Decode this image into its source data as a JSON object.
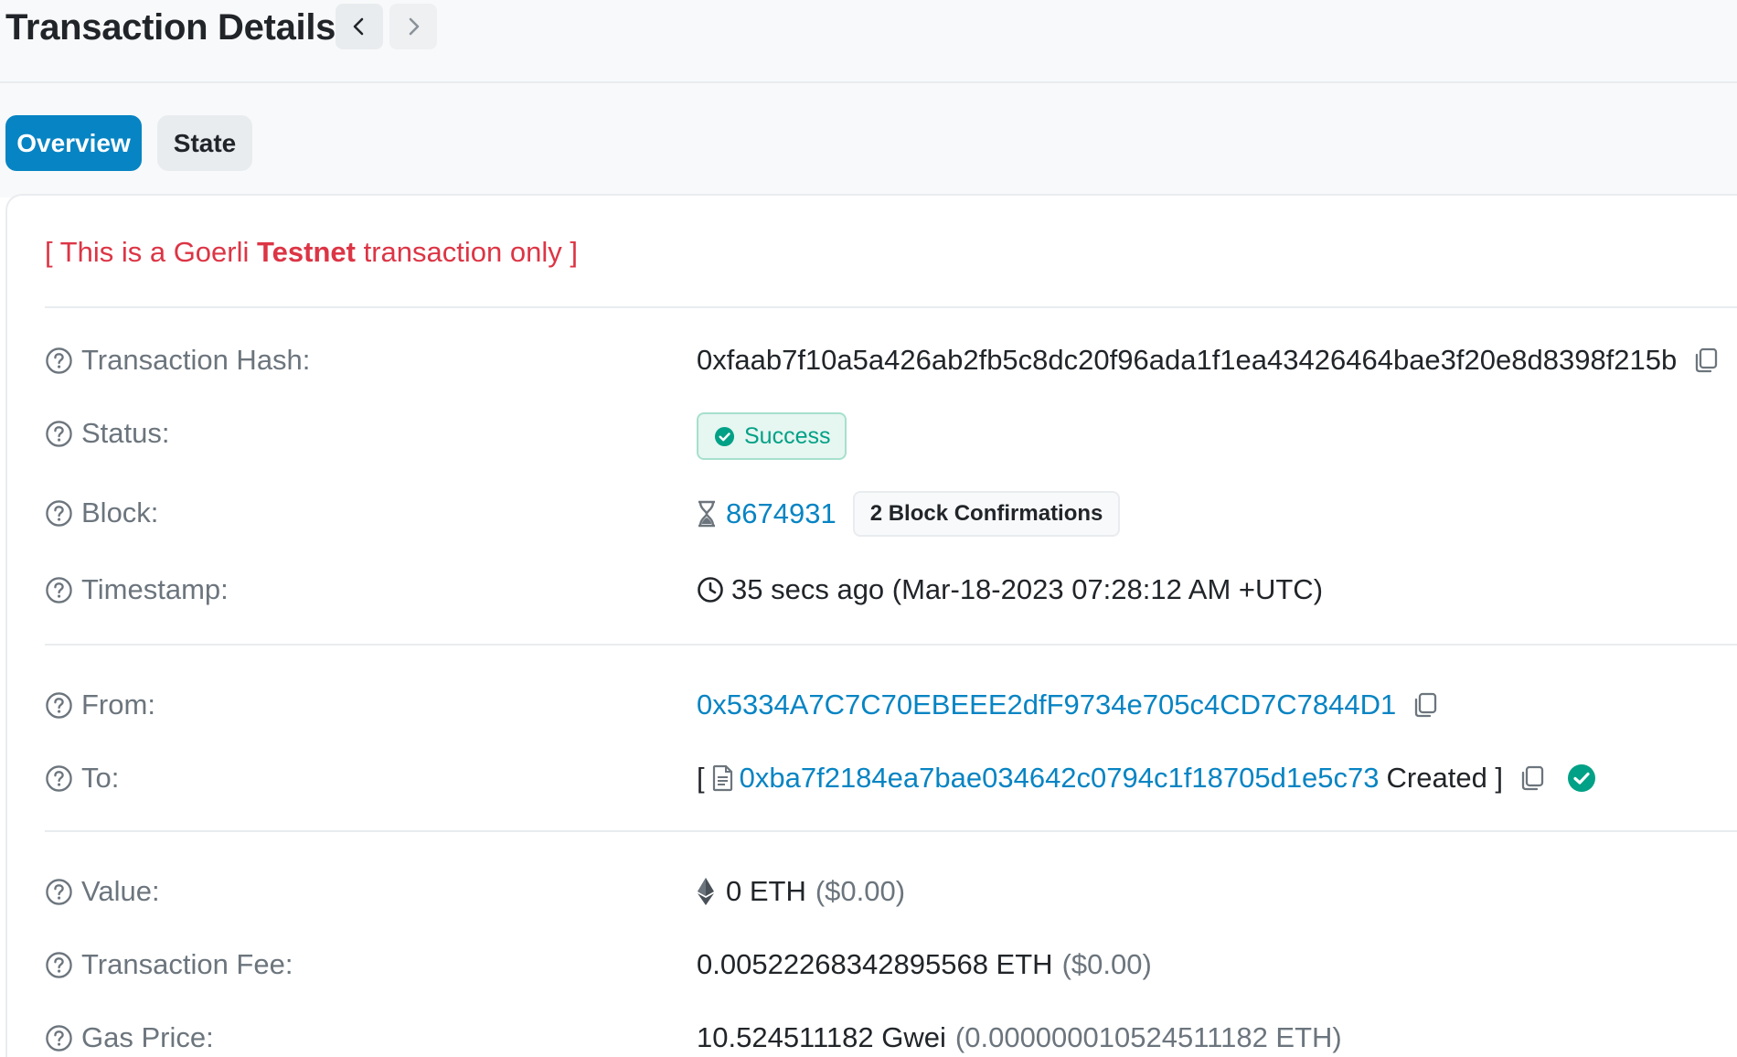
{
  "header": {
    "title": "Transaction Details"
  },
  "tabs": [
    {
      "label": "Overview",
      "active": true
    },
    {
      "label": "State",
      "active": false
    }
  ],
  "notice": {
    "prefix": "[ This is a Goerli ",
    "emphasis": "Testnet",
    "suffix": " transaction only ]"
  },
  "rows": {
    "hash": {
      "label": "Transaction Hash:",
      "value": "0xfaab7f10a5a426ab2fb5c8dc20f96ada1f1ea43426464bae3f20e8d8398f215b"
    },
    "status": {
      "label": "Status:",
      "value": "Success"
    },
    "block": {
      "label": "Block:",
      "value": "8674931",
      "confirmations": "2 Block Confirmations"
    },
    "timestamp": {
      "label": "Timestamp:",
      "value": "35 secs ago (Mar-18-2023 07:28:12 AM +UTC)"
    },
    "from": {
      "label": "From:",
      "value": "0x5334A7C7C70EBEEE2dfF9734e705c4CD7C7844D1"
    },
    "to": {
      "label": "To:",
      "open": "[",
      "value": "0xba7f2184ea7bae034642c0794c1f18705d1e5c73",
      "suffix": "Created ]"
    },
    "value": {
      "label": "Value:",
      "value": "0 ETH",
      "usd": "($0.00)"
    },
    "fee": {
      "label": "Transaction Fee:",
      "value": "0.00522268342895568 ETH",
      "usd": "($0.00)"
    },
    "gas": {
      "label": "Gas Price:",
      "value": "10.524511182 Gwei",
      "eth": "(0.000000010524511182 ETH)"
    }
  },
  "colors": {
    "accent": "#0784c3",
    "danger": "#dc3545",
    "success": "#00a186",
    "muted": "#6c757d"
  }
}
